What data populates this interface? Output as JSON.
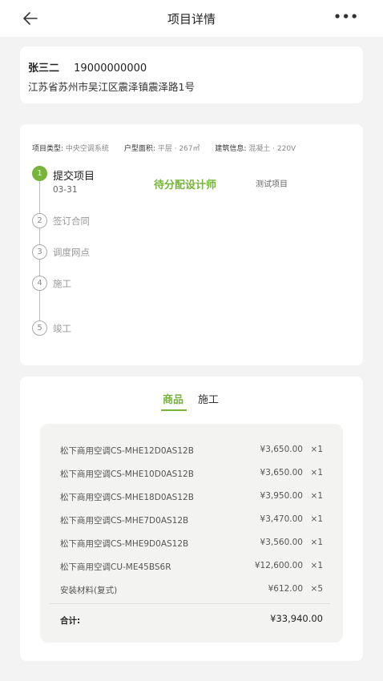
{
  "header": {
    "title": "项目详情",
    "more": "•••"
  },
  "contact": {
    "name": "张三二",
    "phone": "19000000000",
    "address": "江苏省苏州市吴江区震泽镇震泽路1号"
  },
  "project": {
    "info": [
      {
        "label": "项目类型:",
        "value": "中央空调系统"
      },
      {
        "label": "户型面积:",
        "value": "平层 · 267㎡"
      },
      {
        "label": "建筑信息:",
        "value": "混凝土 · 220V"
      }
    ],
    "steps": [
      {
        "num": "1",
        "label": "提交项目",
        "date": "03-31",
        "status": "待分配设计师",
        "note": "测试项目",
        "active": true
      },
      {
        "num": "2",
        "label": "签订合同"
      },
      {
        "num": "3",
        "label": "调度网点"
      },
      {
        "num": "4",
        "label": "施工"
      },
      {
        "num": "5",
        "label": "竣工"
      }
    ]
  },
  "tabs": {
    "goods": "商品",
    "work": "施工"
  },
  "goods": {
    "items": [
      {
        "name": "松下商用空调CS-MHE12D0AS12B",
        "price": "¥3,650.00",
        "qty": "×1"
      },
      {
        "name": "松下商用空调CS-MHE10D0AS12B",
        "price": "¥3,650.00",
        "qty": "×1"
      },
      {
        "name": "松下商用空调CS-MHE18D0AS12B",
        "price": "¥3,950.00",
        "qty": "×1"
      },
      {
        "name": "松下商用空调CS-MHE7D0AS12B",
        "price": "¥3,470.00",
        "qty": "×1"
      },
      {
        "name": "松下商用空调CS-MHE9D0AS12B",
        "price": "¥3,560.00",
        "qty": "×1"
      },
      {
        "name": "松下商用空调CU-ME45BS6R",
        "price": "¥12,600.00",
        "qty": "×1"
      },
      {
        "name": "安装材料(复式)",
        "price": "¥612.00",
        "qty": "×5"
      }
    ],
    "total_label": "合计:",
    "total_value": "¥33,940.00"
  },
  "colors": {
    "accent": "#76b43a",
    "background": "#f3f3f3"
  },
  "icons": {
    "back": "arrow-left-icon",
    "more": "more-dots-icon"
  }
}
